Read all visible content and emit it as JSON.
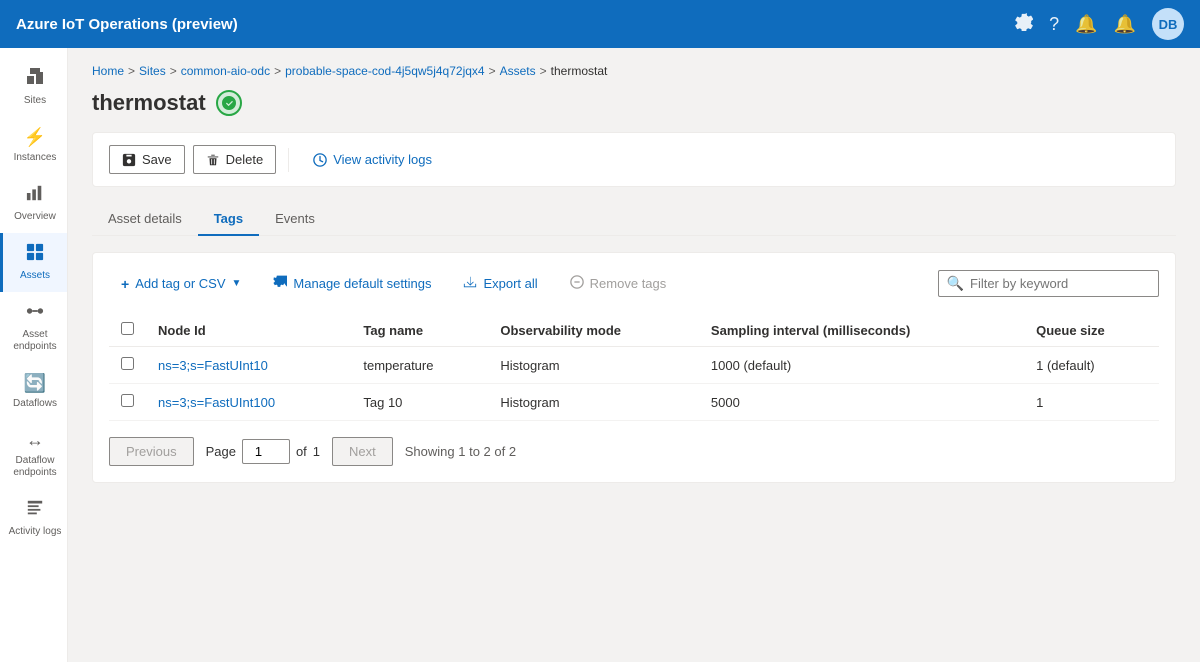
{
  "topbar": {
    "title": "Azure IoT Operations (preview)",
    "avatar_initials": "DB"
  },
  "breadcrumb": {
    "items": [
      "Home",
      "Sites",
      "common-aio-odc",
      "probable-space-cod-4j5qw5j4q72jqx4",
      "Assets"
    ],
    "current": "thermostat"
  },
  "page": {
    "title": "thermostat",
    "status": "connected"
  },
  "toolbar": {
    "save_label": "Save",
    "delete_label": "Delete",
    "activity_logs_label": "View activity logs"
  },
  "tabs": {
    "items": [
      "Asset details",
      "Tags",
      "Events"
    ],
    "active": "Tags"
  },
  "panel": {
    "add_tag_label": "Add tag or CSV",
    "manage_settings_label": "Manage default settings",
    "export_label": "Export all",
    "remove_tags_label": "Remove tags",
    "search_placeholder": "Filter by keyword"
  },
  "table": {
    "columns": [
      "Node Id",
      "Tag name",
      "Observability mode",
      "Sampling interval (milliseconds)",
      "Queue size"
    ],
    "rows": [
      {
        "node_id": "ns=3;s=FastUInt10",
        "tag_name": "temperature",
        "observability_mode": "Histogram",
        "sampling_interval": "1000 (default)",
        "queue_size": "1 (default)"
      },
      {
        "node_id": "ns=3;s=FastUInt100",
        "tag_name": "Tag 10",
        "observability_mode": "Histogram",
        "sampling_interval": "5000",
        "queue_size": "1"
      }
    ]
  },
  "pagination": {
    "previous_label": "Previous",
    "next_label": "Next",
    "page_label": "Page",
    "of_label": "of",
    "current_page": "1",
    "total_pages": "1",
    "showing_text": "Showing 1 to 2 of 2"
  },
  "sidebar": {
    "items": [
      {
        "id": "sites",
        "label": "Sites",
        "icon": "🏢"
      },
      {
        "id": "instances",
        "label": "Instances",
        "icon": "⚡"
      },
      {
        "id": "overview",
        "label": "Overview",
        "icon": "📊"
      },
      {
        "id": "assets",
        "label": "Assets",
        "icon": "📋"
      },
      {
        "id": "asset-endpoints",
        "label": "Asset endpoints",
        "icon": "🔗"
      },
      {
        "id": "dataflows",
        "label": "Dataflows",
        "icon": "🔄"
      },
      {
        "id": "dataflow-endpoints",
        "label": "Dataflow endpoints",
        "icon": "↔"
      },
      {
        "id": "activity-logs",
        "label": "Activity logs",
        "icon": "📝"
      }
    ]
  }
}
